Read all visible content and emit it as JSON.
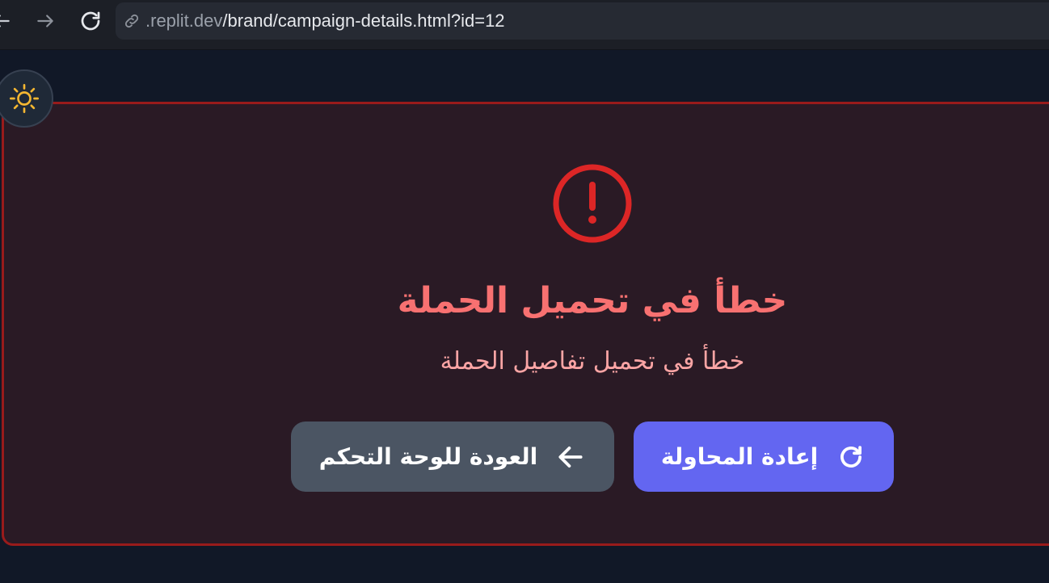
{
  "browser": {
    "url_host": ".replit.dev",
    "url_path": "/brand/campaign-details.html?id=12",
    "icons": {
      "back": "arrow-left-icon",
      "forward": "arrow-right-icon",
      "reload": "reload-icon",
      "link": "link-icon"
    }
  },
  "theme_toggle": {
    "icon": "sun-icon",
    "color": "#f5b731"
  },
  "error": {
    "icon": "exclamation-circle-icon",
    "title": "خطأ في تحميل الحملة",
    "message": "خطأ في تحميل تفاصيل الحملة",
    "colors": {
      "accent": "#dc2626",
      "title": "#f87171",
      "message": "#fca5a5",
      "border": "#991b1b"
    }
  },
  "actions": {
    "retry_label": "إعادة المحاولة",
    "retry_icon": "refresh-icon",
    "retry_color": "#6366f1",
    "back_label": "العودة للوحة التحكم",
    "back_icon": "arrow-left-icon",
    "back_color": "#4b5563"
  }
}
